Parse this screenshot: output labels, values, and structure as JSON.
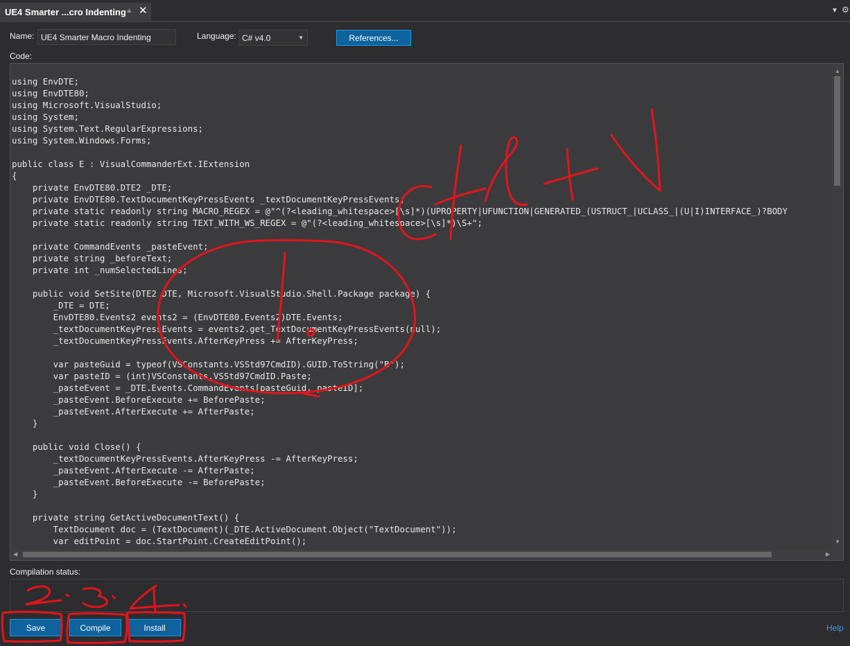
{
  "tab": {
    "title": "UE4 Smarter ...cro Indenting",
    "pin_icon": "pin-icon",
    "close_icon": "close-icon"
  },
  "form": {
    "name_label": "Name:",
    "name_value": "UE4 Smarter Macro Indenting",
    "language_label": "Language:",
    "language_value": "C# v4.0",
    "references_label": "References...",
    "code_label": "Code:"
  },
  "code": [
    "using EnvDTE;",
    "using EnvDTE80;",
    "using Microsoft.VisualStudio;",
    "using System;",
    "using System.Text.RegularExpressions;",
    "using System.Windows.Forms;",
    "",
    "public class E : VisualCommanderExt.IExtension",
    "{",
    "    private EnvDTE80.DTE2 _DTE;",
    "    private EnvDTE80.TextDocumentKeyPressEvents _textDocumentKeyPressEvents;",
    "    private static readonly string MACRO_REGEX = @\"^(?<leading_whitespace>[\\s]*)(UPROPERTY|UFUNCTION|GENERATED_(USTRUCT_|UCLASS_|(U|I)INTERFACE_)?BODY",
    "    private static readonly string TEXT_WITH_WS_REGEX = @\"(?<leading_whitespace>[\\s]*)\\S+\";",
    "",
    "    private CommandEvents _pasteEvent;",
    "    private string _beforeText;",
    "    private int _numSelectedLines;",
    "",
    "    public void SetSite(DTE2 DTE, Microsoft.VisualStudio.Shell.Package package) {",
    "        _DTE = DTE;",
    "        EnvDTE80.Events2 events2 = (EnvDTE80.Events2)DTE.Events;",
    "        _textDocumentKeyPressEvents = events2.get_TextDocumentKeyPressEvents(null);",
    "        _textDocumentKeyPressEvents.AfterKeyPress += AfterKeyPress;",
    "",
    "        var pasteGuid = typeof(VSConstants.VSStd97CmdID).GUID.ToString(\"B\");",
    "        var pasteID = (int)VSConstants.VSStd97CmdID.Paste;",
    "        _pasteEvent = _DTE.Events.CommandEvents[pasteGuid, pasteID];",
    "        _pasteEvent.BeforeExecute += BeforePaste;",
    "        _pasteEvent.AfterExecute += AfterPaste;",
    "    }",
    "",
    "    public void Close() {",
    "        _textDocumentKeyPressEvents.AfterKeyPress -= AfterKeyPress;",
    "        _pasteEvent.AfterExecute -= AfterPaste;",
    "        _pasteEvent.BeforeExecute -= BeforePaste;",
    "    }",
    "",
    "    private string GetActiveDocumentText() {",
    "        TextDocument doc = (TextDocument)(_DTE.ActiveDocument.Object(\"TextDocument\"));",
    "        var editPoint = doc.StartPoint.CreateEditPoint();"
  ],
  "status": {
    "label": "Compilation status:",
    "value": ""
  },
  "buttons": {
    "save": "Save",
    "compile": "Compile",
    "install": "Install",
    "help": "Help"
  },
  "annotations": {
    "color": "#e3141b",
    "step_1": "1",
    "step_2": "2.",
    "step_3": "3.",
    "step_4": "4.",
    "shortcut": "Ctrl+V"
  },
  "colors": {
    "background": "#2d2d30",
    "editor": "#3b3b3d",
    "button": "#0e639c",
    "link": "#3794ff"
  }
}
